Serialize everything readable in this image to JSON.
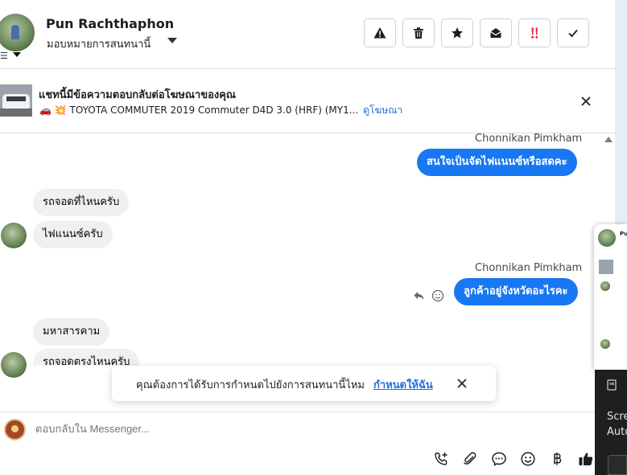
{
  "header": {
    "contact_name": "Pun Rachthaphon",
    "assign_label": "มอบหมายการสนทนานี้",
    "toolbar": [
      {
        "name": "warning-button",
        "icon": "warning-icon"
      },
      {
        "name": "delete-button",
        "icon": "trash-icon"
      },
      {
        "name": "star-button",
        "icon": "star-icon"
      },
      {
        "name": "mark-unread-button",
        "icon": "envelope-open-icon"
      },
      {
        "name": "priority-button",
        "icon": "double-exclamation-icon",
        "color": "#e41e3f"
      },
      {
        "name": "done-button",
        "icon": "checkmark-icon"
      }
    ]
  },
  "ad": {
    "title": "แชทนี้มีข้อความตอบกลับต่อโฆษณาของคุณ",
    "subtitle": "🚗 💥 TOYOTA COMMUTER 2019 Commuter D4D 3.0 (HRF) (MY1...",
    "link": "ดูโฆษณา"
  },
  "messages": [
    {
      "sender": "Chonnikan Pimkham",
      "text": "สนใจเป็นจัดไฟแนนซ์หรือสดคะ",
      "direction": "out"
    },
    {
      "text": "รถจอดที่ไหนครับ",
      "direction": "in"
    },
    {
      "text": "ไฟแนนซ์ครับ",
      "direction": "in"
    },
    {
      "sender": "Chonnikan Pimkham",
      "text": "ลูกค้าอยู่จังหวัดอะไรคะ",
      "direction": "out"
    },
    {
      "text": "มหาสารคาม",
      "direction": "in"
    },
    {
      "text": "รถจอดตรงไหนครับ",
      "direction": "in"
    }
  ],
  "toast": {
    "text": "คุณต้องการได้รับการกำหนดไปยังการสนทนานี้ไหม",
    "action": "กำหนดให้ฉัน"
  },
  "composer": {
    "placeholder": "ตอบกลับใน Messenger...",
    "icons": [
      "add-call-icon",
      "attachment-icon",
      "saved-reply-icon",
      "emoji-icon",
      "baht-icon",
      "like-icon"
    ]
  },
  "side_panel": {
    "name_fragment": "Pun",
    "dark_text_1": "Scre",
    "dark_text_2": "Auto"
  },
  "colors": {
    "accent": "#1877f2",
    "link": "#216fdb",
    "priority": "#e41e3f"
  }
}
